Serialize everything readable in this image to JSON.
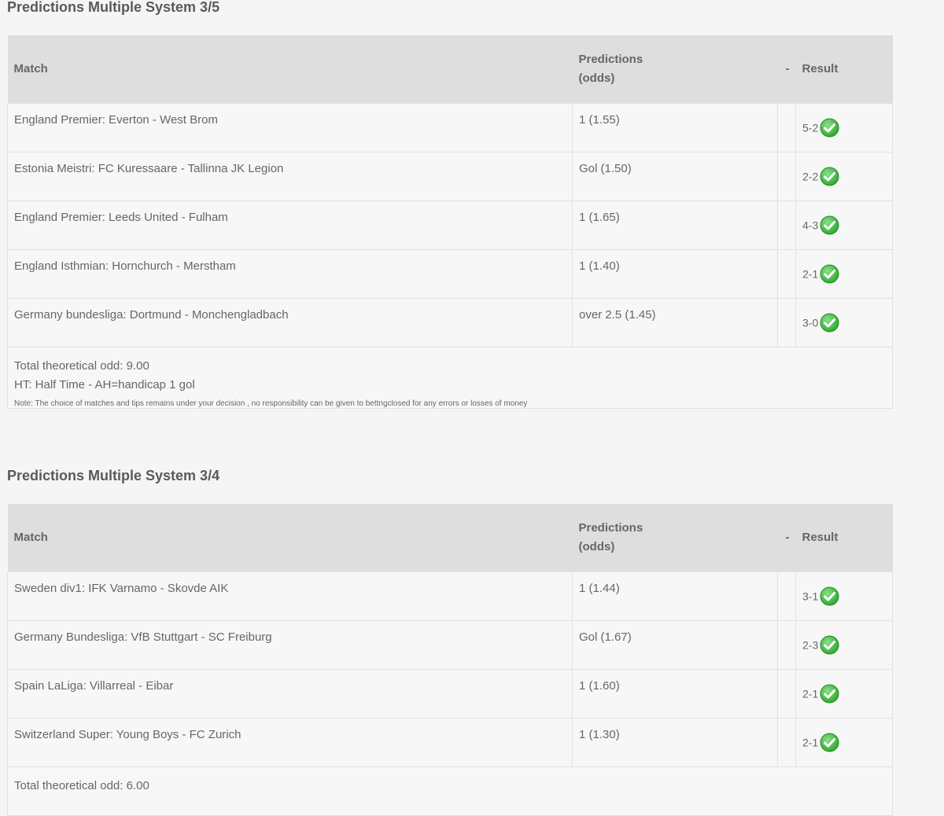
{
  "sections": [
    {
      "title": "Predictions Multiple System 3/5",
      "headers": {
        "match": "Match",
        "pred_line1": "Predictions",
        "pred_line2": "(odds)",
        "dash": "-",
        "result": "Result"
      },
      "rows": [
        {
          "match": "England Premier: Everton - West Brom",
          "prediction": "1 (1.55)",
          "result": "5-2"
        },
        {
          "match": "Estonia Meistri: FC Kuressaare - Tallinna JK Legion",
          "prediction": "Gol (1.50)",
          "result": "2-2"
        },
        {
          "match": "England Premier: Leeds United - Fulham",
          "prediction": "1 (1.65)",
          "result": "4-3"
        },
        {
          "match": "England Isthmian: Hornchurch - Merstham",
          "prediction": "1 (1.40)",
          "result": "2-1"
        },
        {
          "match": "Germany bundesliga: Dortmund - Monchengladbach",
          "prediction": "over 2.5 (1.45)",
          "result": "3-0"
        }
      ],
      "footer": {
        "total": "Total theoretical odd: 9.00",
        "legend": "HT: Half Time - AH=handicap 1 gol",
        "note": "Note: The choice of matches and tips remains under your decision , no responsibility can be given to bettngclosed for any errors or losses of money"
      }
    },
    {
      "title": "Predictions Multiple System 3/4",
      "headers": {
        "match": "Match",
        "pred_line1": "Predictions",
        "pred_line2": "(odds)",
        "dash": "-",
        "result": "Result"
      },
      "rows": [
        {
          "match": "Sweden div1: IFK Varnamo - Skovde AIK",
          "prediction": "1 (1.44)",
          "result": "3-1"
        },
        {
          "match": "Germany Bundesliga: VfB Stuttgart - SC Freiburg",
          "prediction": "Gol (1.67)",
          "result": "2-3"
        },
        {
          "match": "Spain LaLiga: Villarreal - Eibar",
          "prediction": "1 (1.60)",
          "result": "2-1"
        },
        {
          "match": "Switzerland Super: Young Boys - FC Zurich",
          "prediction": "1 (1.30)",
          "result": "2-1"
        }
      ],
      "footer": {
        "total": "Total theoretical odd: 6.00"
      }
    }
  ],
  "icons": {
    "result_status": "check-circle-icon",
    "check_color": "#3cb93c"
  }
}
